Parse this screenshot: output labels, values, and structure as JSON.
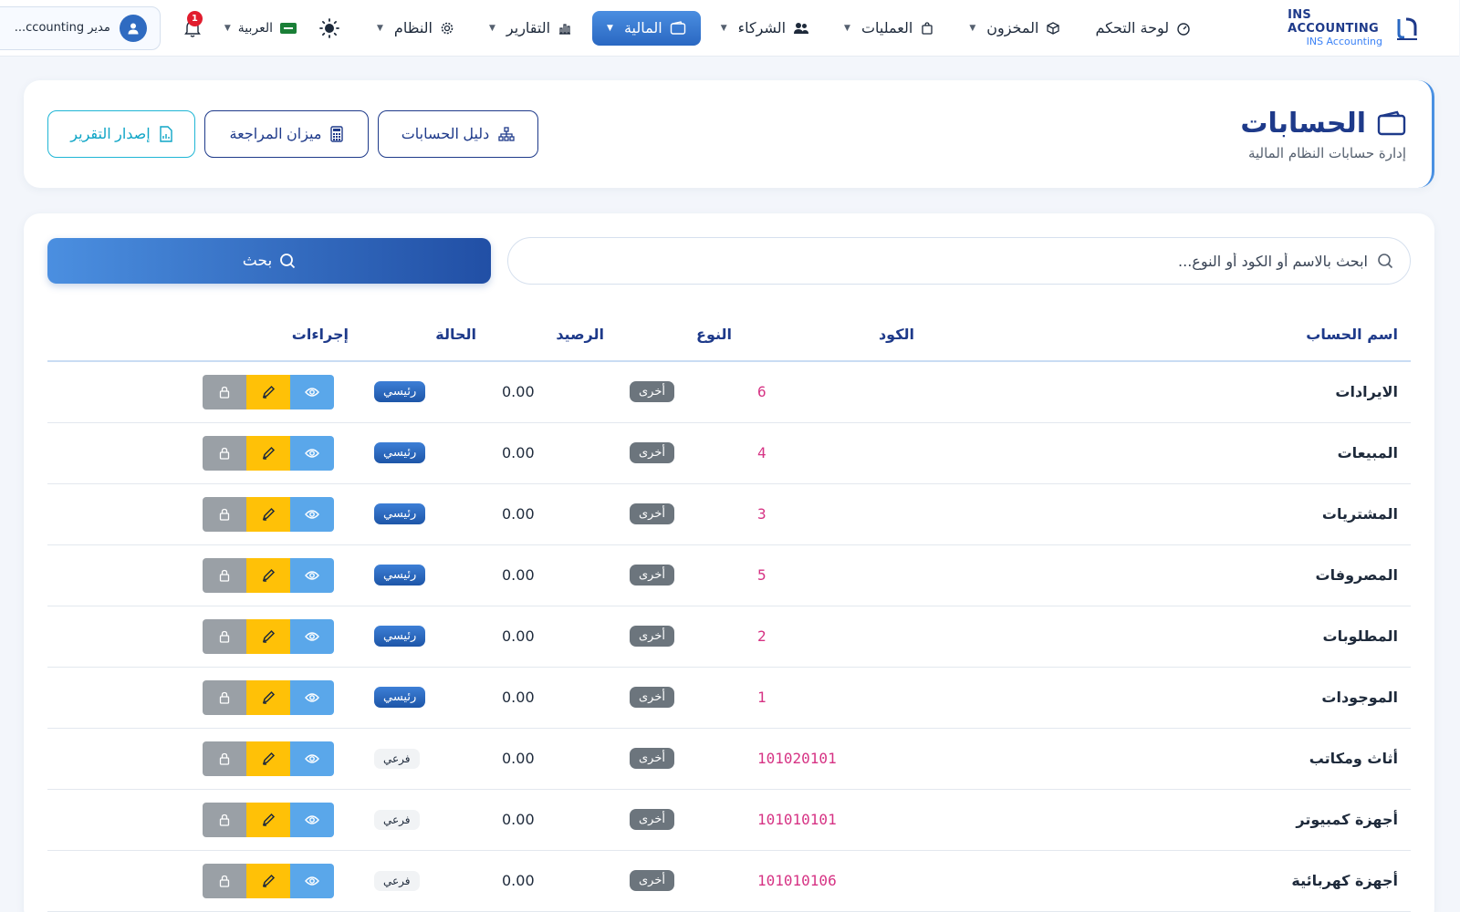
{
  "brand": {
    "name": "INS ACCOUNTING",
    "subtitle": "INS Accounting"
  },
  "nav": {
    "items": [
      {
        "label": "لوحة التحكم",
        "icon": "dashboard-gauge-icon",
        "has_caret": false
      },
      {
        "label": "المخزون",
        "icon": "box-icon",
        "has_caret": true
      },
      {
        "label": "العمليات",
        "icon": "shopping-bag-icon",
        "has_caret": true
      },
      {
        "label": "الشركاء",
        "icon": "users-icon",
        "has_caret": true
      },
      {
        "label": "المالية",
        "icon": "wallet-icon",
        "has_caret": true,
        "active": true
      },
      {
        "label": "التقارير",
        "icon": "bar-chart-icon",
        "has_caret": true
      },
      {
        "label": "النظام",
        "icon": "gear-icon",
        "has_caret": true
      }
    ]
  },
  "tools": {
    "language_label": "العربية",
    "notification_count": "1",
    "user_label": "مدير ccounting..."
  },
  "header": {
    "title": "الحسابات",
    "subtitle": "إدارة حسابات النظام المالية",
    "buttons": {
      "chart_of_accounts": "دليل الحسابات",
      "trial_balance": "ميزان المراجعة",
      "issue_report": "إصدار التقرير"
    }
  },
  "search": {
    "placeholder": "ابحث بالاسم أو الكود أو النوع...",
    "value": "",
    "button_label": "بحث"
  },
  "table": {
    "columns": {
      "name": "اسم الحساب",
      "code": "الكود",
      "type": "النوع",
      "balance": "الرصيد",
      "status": "الحالة",
      "actions": "إجراءات"
    },
    "rows": [
      {
        "name": "الايرادات",
        "code": "6",
        "type": "أخرى",
        "balance": "0.00",
        "status": "رئيسي",
        "status_kind": "main"
      },
      {
        "name": "المبيعات",
        "code": "4",
        "type": "أخرى",
        "balance": "0.00",
        "status": "رئيسي",
        "status_kind": "main"
      },
      {
        "name": "المشتريات",
        "code": "3",
        "type": "أخرى",
        "balance": "0.00",
        "status": "رئيسي",
        "status_kind": "main"
      },
      {
        "name": "المصروفات",
        "code": "5",
        "type": "أخرى",
        "balance": "0.00",
        "status": "رئيسي",
        "status_kind": "main"
      },
      {
        "name": "المطلوبات",
        "code": "2",
        "type": "أخرى",
        "balance": "0.00",
        "status": "رئيسي",
        "status_kind": "main"
      },
      {
        "name": "الموجودات",
        "code": "1",
        "type": "أخرى",
        "balance": "0.00",
        "status": "رئيسي",
        "status_kind": "main"
      },
      {
        "name": "أثاث ومكاتب",
        "code": "101020101",
        "type": "أخرى",
        "balance": "0.00",
        "status": "فرعي",
        "status_kind": "sub"
      },
      {
        "name": "أجهزة كمبيوتر",
        "code": "101010101",
        "type": "أخرى",
        "balance": "0.00",
        "status": "فرعي",
        "status_kind": "sub"
      },
      {
        "name": "أجهزة كهربائية",
        "code": "101010106",
        "type": "أخرى",
        "balance": "0.00",
        "status": "فرعي",
        "status_kind": "sub"
      }
    ]
  },
  "colors": {
    "primary": "#1e3a8a",
    "accent": "#2a68c2",
    "code_pink": "#d63384",
    "edit_yellow": "#ffc107",
    "view_blue": "#5aa7ea",
    "lock_gray": "#9aa0a6",
    "info_cyan": "#0ea5c6"
  }
}
